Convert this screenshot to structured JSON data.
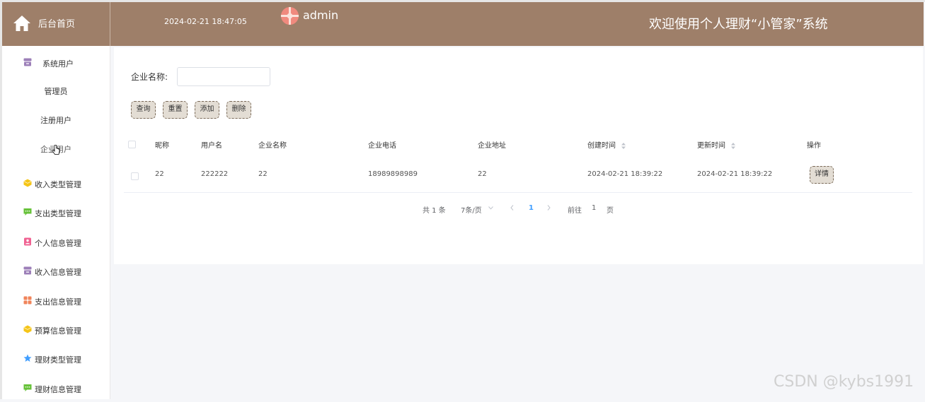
{
  "header": {
    "home_label": "后台首页",
    "datetime": "2024-02-21 18:47:05",
    "username": "admin",
    "welcome": "欢迎使用个人理财“小管家”系统",
    "bg_color": "#9e7f69"
  },
  "sidebar": {
    "system_user": {
      "label": "系统用户",
      "icon": "archive-icon",
      "children": [
        "管理员",
        "注册用户",
        "企业用户"
      ]
    },
    "items": [
      {
        "label": "收入类型管理",
        "icon": "cube-icon",
        "color": "#f5c518"
      },
      {
        "label": "支出类型管理",
        "icon": "chat-icon",
        "color": "#67c23a"
      },
      {
        "label": "个人信息管理",
        "icon": "contact-icon",
        "color": "#f06292"
      },
      {
        "label": "收入信息管理",
        "icon": "archive-icon",
        "color": "#9c7fb8"
      },
      {
        "label": "支出信息管理",
        "icon": "grid-icon",
        "color": "#f0845a"
      },
      {
        "label": "预算信息管理",
        "icon": "cube-icon",
        "color": "#f5c518"
      },
      {
        "label": "理财类型管理",
        "icon": "star-icon",
        "color": "#409eff"
      },
      {
        "label": "理财信息管理",
        "icon": "chat-icon",
        "color": "#67c23a"
      }
    ]
  },
  "search": {
    "label": "企业名称:",
    "value": "",
    "placeholder": ""
  },
  "buttons": {
    "query": "查询",
    "reset": "重置",
    "add": "添加",
    "delete": "删除",
    "detail": "详情"
  },
  "table": {
    "headers": [
      "昵称",
      "用户名",
      "企业名称",
      "企业电话",
      "企业地址",
      "创建时间",
      "更新时间",
      "操作"
    ],
    "rows": [
      [
        "22",
        "222222",
        "22",
        "18989898989",
        "22",
        "2024-02-21 18:39:22",
        "2024-02-21 18:39:22"
      ]
    ]
  },
  "pagination": {
    "total": "共 1 条",
    "page_size": "7条/页",
    "current": "1",
    "goto_label": "前往",
    "goto_value": "1",
    "page_unit": "页"
  },
  "watermark": "CSDN @kybs1991"
}
